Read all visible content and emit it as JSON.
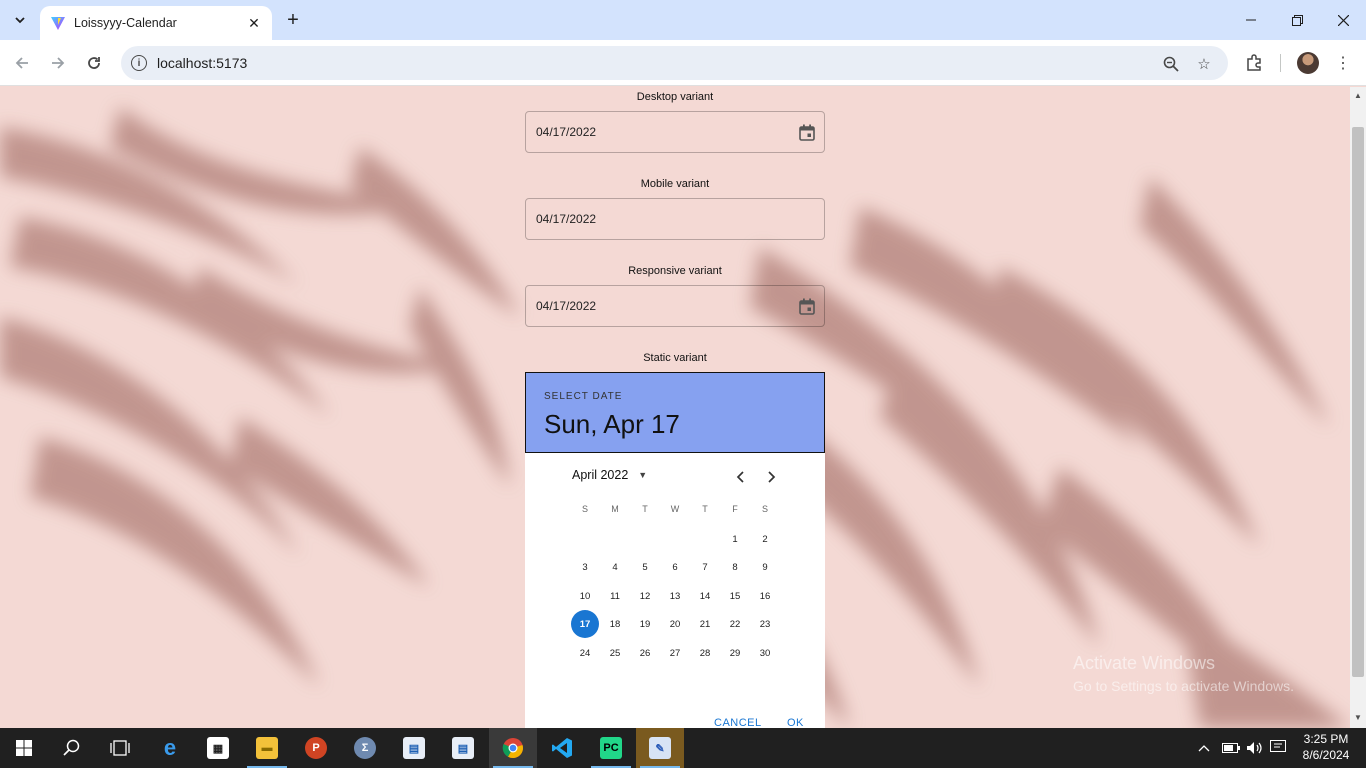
{
  "browser": {
    "tab_title": "Loissyyy-Calendar",
    "url": "localhost:5173"
  },
  "page": {
    "variants": [
      {
        "label": "Desktop variant",
        "value": "04/17/2022",
        "has_icon": true
      },
      {
        "label": "Mobile variant",
        "value": "04/17/2022",
        "has_icon": false
      },
      {
        "label": "Responsive variant",
        "value": "04/17/2022",
        "has_icon": true
      }
    ],
    "static_label": "Static variant",
    "picker": {
      "select_label": "SELECT DATE",
      "selected_date": "Sun, Apr 17",
      "month_label": "April 2022",
      "weekdays": [
        "S",
        "M",
        "T",
        "W",
        "T",
        "F",
        "S"
      ],
      "weeks": [
        [
          "",
          "",
          "",
          "",
          "",
          "1",
          "2"
        ],
        [
          "3",
          "4",
          "5",
          "6",
          "7",
          "8",
          "9"
        ],
        [
          "10",
          "11",
          "12",
          "13",
          "14",
          "15",
          "16"
        ],
        [
          "17",
          "18",
          "19",
          "20",
          "21",
          "22",
          "23"
        ],
        [
          "24",
          "25",
          "26",
          "27",
          "28",
          "29",
          "30"
        ]
      ],
      "selected_day": "17",
      "cancel_label": "CANCEL",
      "ok_label": "OK",
      "header_color": "#86a1f0",
      "accent_color": "#1976d2"
    },
    "watermark": {
      "line1": "Activate Windows",
      "line2": "Go to Settings to activate Windows."
    }
  },
  "taskbar": {
    "time": "3:25 PM",
    "date": "8/6/2024"
  }
}
